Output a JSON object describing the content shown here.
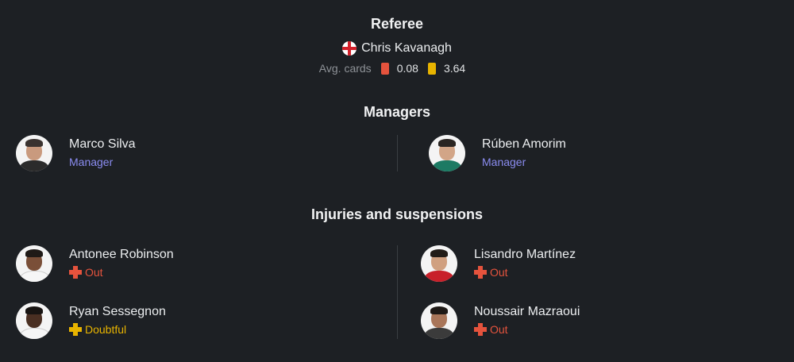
{
  "referee": {
    "title": "Referee",
    "name": "Chris Kavanagh",
    "avg_cards_label": "Avg. cards",
    "red_avg": "0.08",
    "yellow_avg": "3.64"
  },
  "managers": {
    "title": "Managers",
    "home": {
      "name": "Marco Silva",
      "role": "Manager"
    },
    "away": {
      "name": "Rúben Amorim",
      "role": "Manager"
    }
  },
  "injuries": {
    "title": "Injuries and suspensions",
    "home": [
      {
        "name": "Antonee Robinson",
        "status": "Out"
      },
      {
        "name": "Ryan Sessegnon",
        "status": "Doubtful"
      }
    ],
    "away": [
      {
        "name": "Lisandro Martínez",
        "status": "Out"
      },
      {
        "name": "Noussair Mazraoui",
        "status": "Out"
      }
    ]
  },
  "colors": {
    "background": "#1d2024",
    "role_accent": "#8a8cf0",
    "out": "#e5533d",
    "doubtful": "#e8b400"
  }
}
